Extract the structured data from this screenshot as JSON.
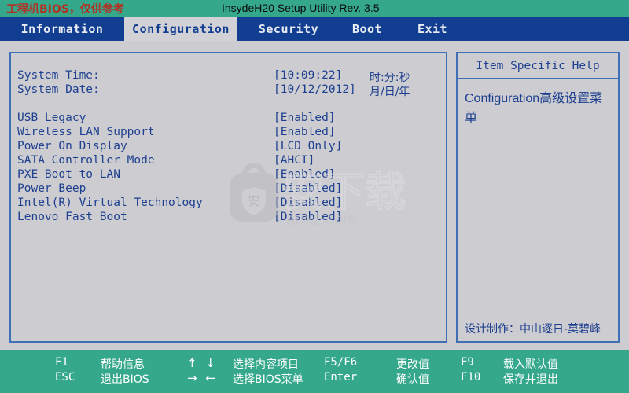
{
  "titlebar": {
    "note": "工程机BIOS，仅供参考",
    "title": "InsydeH20 Setup Utility Rev. 3.5",
    "note_color": "#b03225",
    "background": "#35a88c"
  },
  "tabs": [
    {
      "label": "Information",
      "active": false
    },
    {
      "label": "Configuration",
      "active": true
    },
    {
      "label": "Security",
      "active": false
    },
    {
      "label": "Boot",
      "active": false
    },
    {
      "label": "Exit",
      "active": false
    }
  ],
  "settings": [
    {
      "label": "System Time:",
      "value": "[10:09:22]",
      "hint": "时:分:秒"
    },
    {
      "label": "System Date:",
      "value": "[10/12/2012]",
      "hint": "月/日/年"
    },
    {
      "label": "",
      "value": "",
      "hint": ""
    },
    {
      "label": "USB Legacy",
      "value": "[Enabled]",
      "hint": ""
    },
    {
      "label": "Wireless LAN Support",
      "value": "[Enabled]",
      "hint": ""
    },
    {
      "label": "Power On Display",
      "value": "[LCD Only]",
      "hint": ""
    },
    {
      "label": "SATA Controller Mode",
      "value": "[AHCI]",
      "hint": ""
    },
    {
      "label": "PXE Boot to LAN",
      "value": "[Enabled]",
      "hint": ""
    },
    {
      "label": "Power Beep",
      "value": "[Disabled]",
      "hint": ""
    },
    {
      "label": "Intel(R) Virtual Technology",
      "value": "[Disabled]",
      "hint": ""
    },
    {
      "label": "Lenovo Fast Boot",
      "value": "[Disabled]",
      "hint": ""
    }
  ],
  "help": {
    "header": "Item Specific Help",
    "body": "Configuration高级设置菜单",
    "credit": "设计制作：中山逐日-莫碧峰"
  },
  "watermark": {
    "glyph": "安",
    "text": "安下载",
    "domain": "anxz.com"
  },
  "footer": {
    "rows": [
      {
        "cells": [
          {
            "key": "F1",
            "desc": "帮助信息"
          },
          {
            "key": "↑ ↓",
            "desc": "选择内容项目"
          },
          {
            "key": "F5/F6",
            "desc": "更改值"
          },
          {
            "key": "F9",
            "desc": "载入默认值"
          }
        ]
      },
      {
        "cells": [
          {
            "key": "ESC",
            "desc": "退出BIOS"
          },
          {
            "key": "→ ←",
            "desc": "选择BIOS菜单"
          },
          {
            "key": "Enter",
            "desc": "确认值"
          },
          {
            "key": "F10",
            "desc": "保存并退出"
          }
        ]
      }
    ],
    "background": "#35a88c"
  },
  "colors": {
    "screen_background": "#cdcdd1",
    "tabbar_background": "#123e92",
    "active_tab_background": "#d2d2d6",
    "text_blue": "#1d3f8f",
    "border_blue": "#3f6fb5",
    "teal": "#35a88c"
  }
}
